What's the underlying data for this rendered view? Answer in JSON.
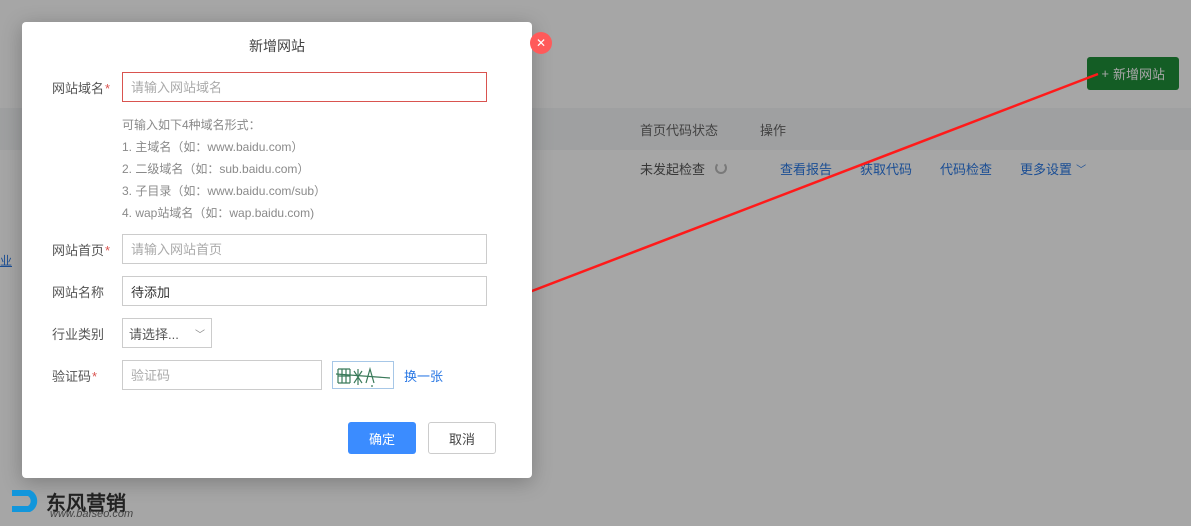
{
  "header": {
    "add_site_label": "新增网站"
  },
  "table": {
    "col_status": "首页代码状态",
    "col_op": "操作",
    "row": {
      "status": "未发起检查",
      "ops": {
        "report": "查看报告",
        "getcode": "获取代码",
        "checkcode": "代码检查",
        "more": "更多设置"
      }
    }
  },
  "sidebar": {
    "link": "业"
  },
  "modal": {
    "title": "新增网站",
    "fields": {
      "domain": {
        "label": "网站域名",
        "placeholder": "请输入网站域名"
      },
      "home": {
        "label": "网站首页",
        "placeholder": "请输入网站首页"
      },
      "name": {
        "label": "网站名称",
        "value": "待添加"
      },
      "industry": {
        "label": "行业类别",
        "placeholder": "请选择..."
      },
      "captcha": {
        "label": "验证码",
        "placeholder": "验证码",
        "refresh": "换一张"
      }
    },
    "hints": {
      "intro": "可输入如下4种域名形式：",
      "l1": "1. 主域名（如：www.baidu.com）",
      "l2": "2. 二级域名（如：sub.baidu.com）",
      "l3": "3. 子目录（如：www.baidu.com/sub）",
      "l4": "4. wap站域名（如：wap.baidu.com)"
    },
    "actions": {
      "ok": "确定",
      "cancel": "取消"
    }
  },
  "logo": {
    "brand": "东风营销",
    "url": "www.bafseo.com"
  }
}
